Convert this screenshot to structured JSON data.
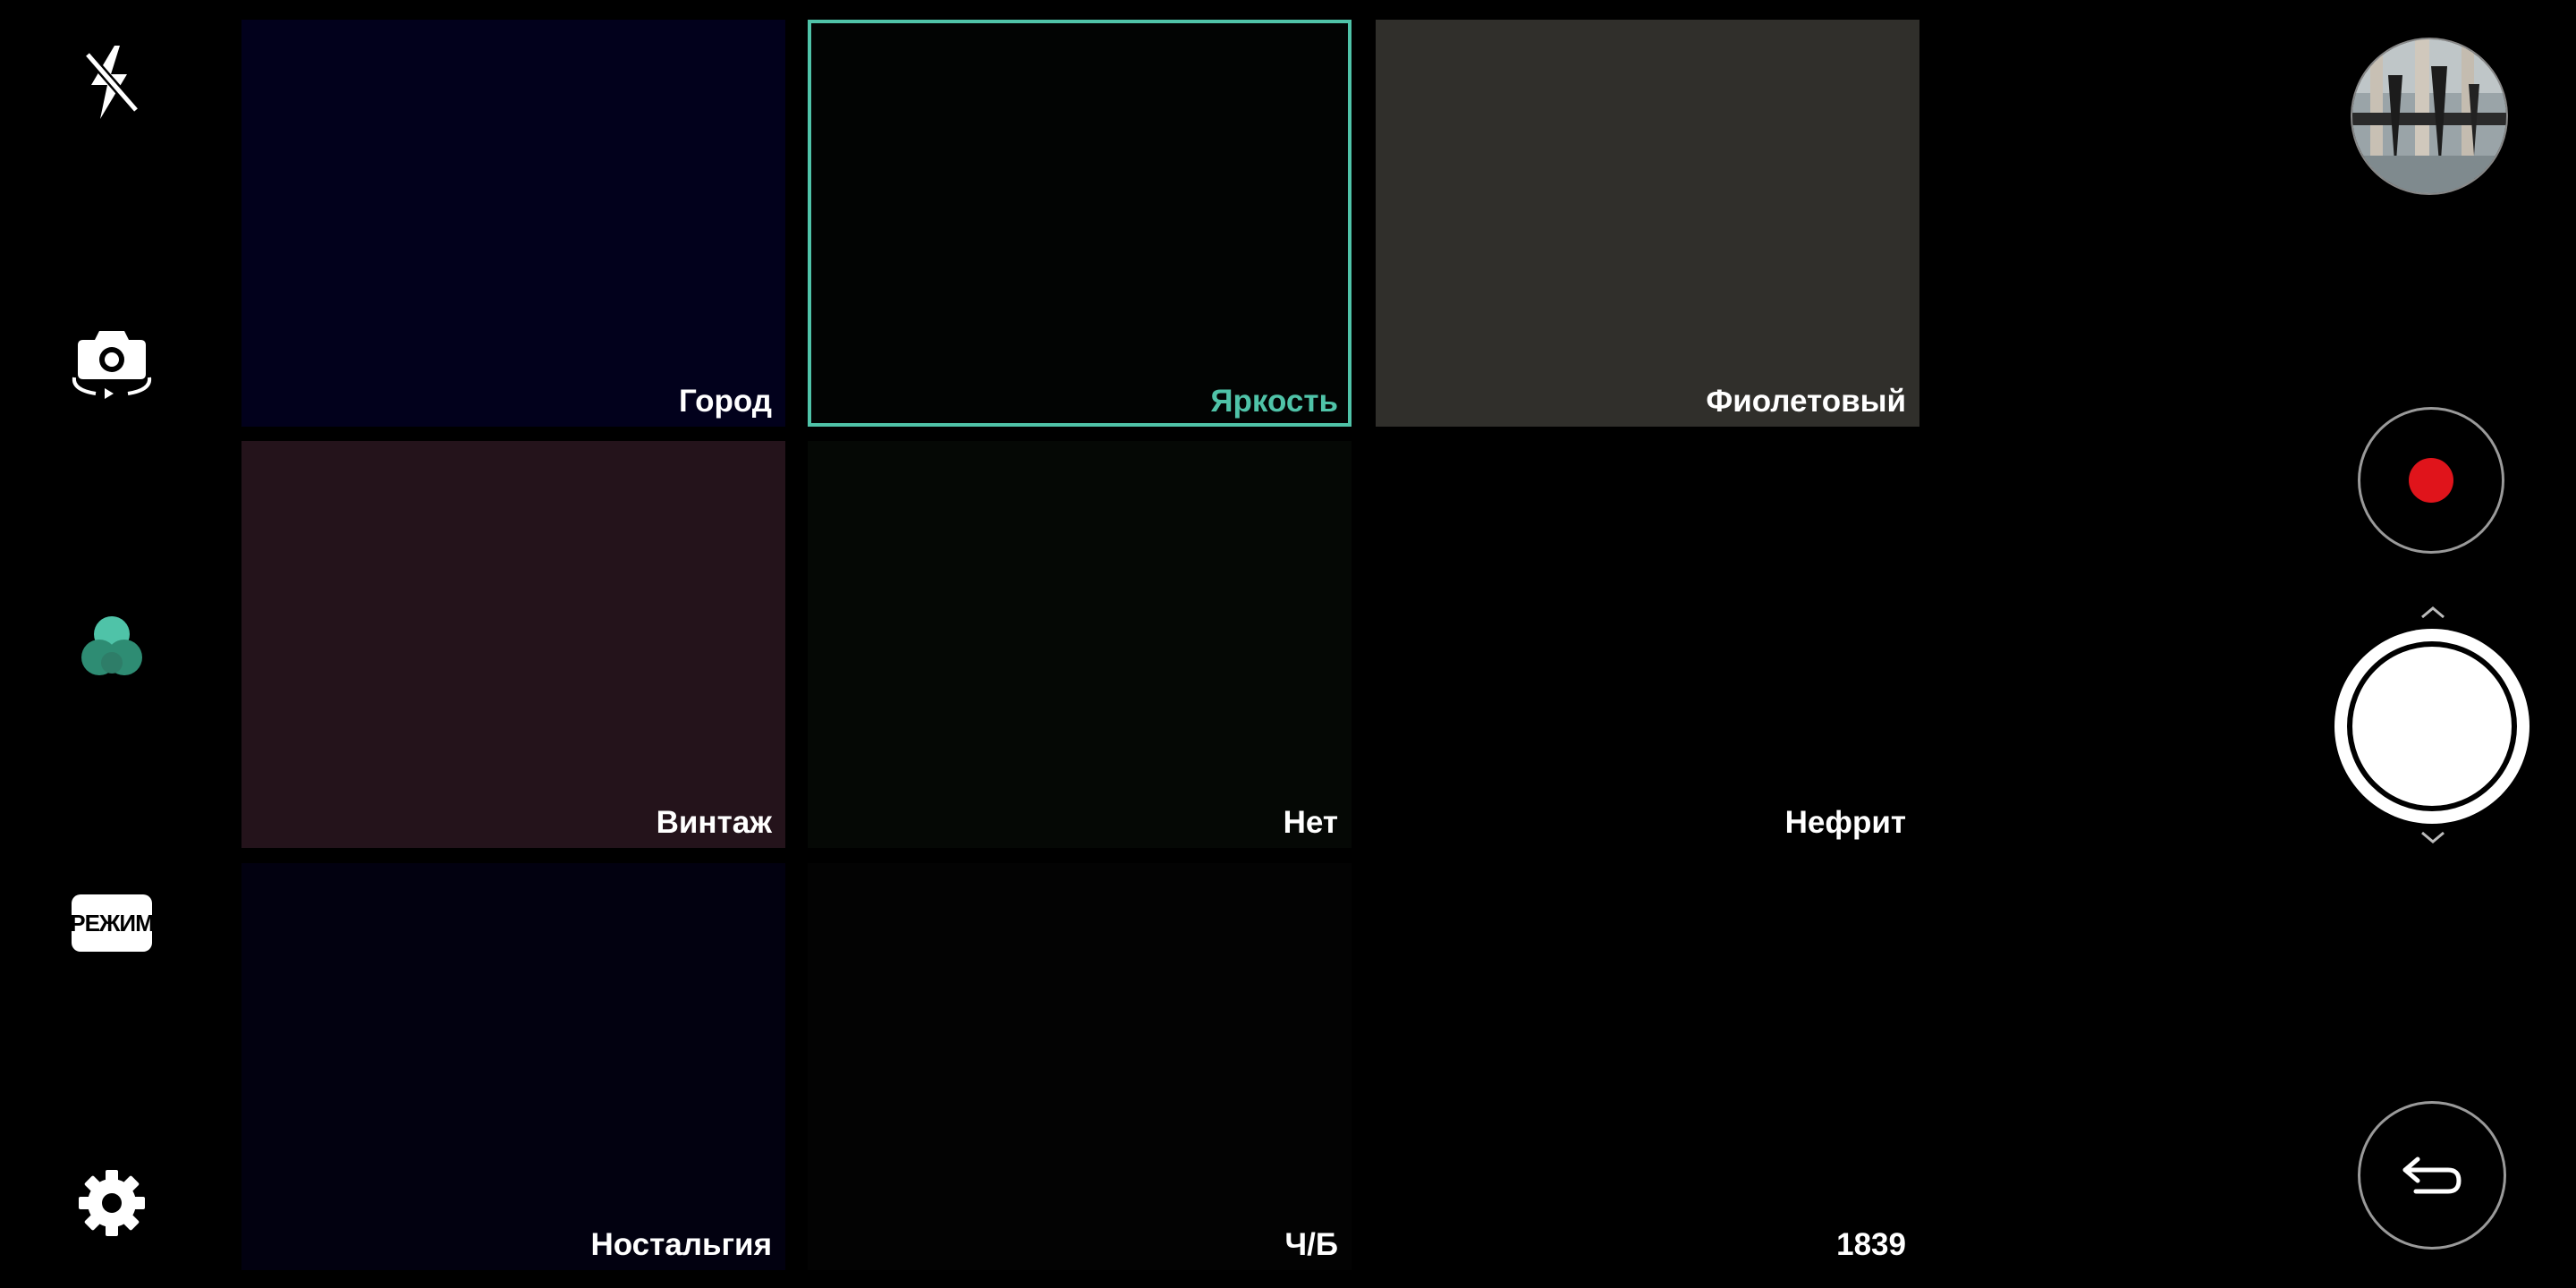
{
  "left_toolbar": {
    "flash": {
      "icon": "flash-off-icon"
    },
    "switch_camera": {
      "icon": "camera-switch-icon"
    },
    "filters": {
      "icon": "color-filter-icon",
      "active_color": "#4fc3a8"
    },
    "mode": {
      "label": "РЕЖИМ"
    },
    "settings": {
      "icon": "gear-icon"
    }
  },
  "filters": {
    "selected": "Яркость",
    "accent_color": "#4fc3a8",
    "items": [
      {
        "label": "Город",
        "color": "#02011c"
      },
      {
        "label": "Яркость",
        "color": "#020403"
      },
      {
        "label": "Фиолетовый",
        "color": "#302f2b"
      },
      {
        "label": "Винтаж",
        "color": "#24131b"
      },
      {
        "label": "Нет",
        "color": "#050805"
      },
      {
        "label": "Нефрит",
        "color": "#000000"
      },
      {
        "label": "Ностальгия",
        "color": "#020110"
      },
      {
        "label": "Ч/Б",
        "color": "#030303"
      },
      {
        "label": "1839",
        "color": "#000000"
      }
    ]
  },
  "right_controls": {
    "gallery": {
      "icon": "gallery-thumbnail"
    },
    "record": {
      "icon": "record-icon",
      "color": "#e0141b"
    },
    "shutter": {
      "icon": "shutter-icon"
    },
    "back": {
      "icon": "back-arrow-icon"
    }
  }
}
